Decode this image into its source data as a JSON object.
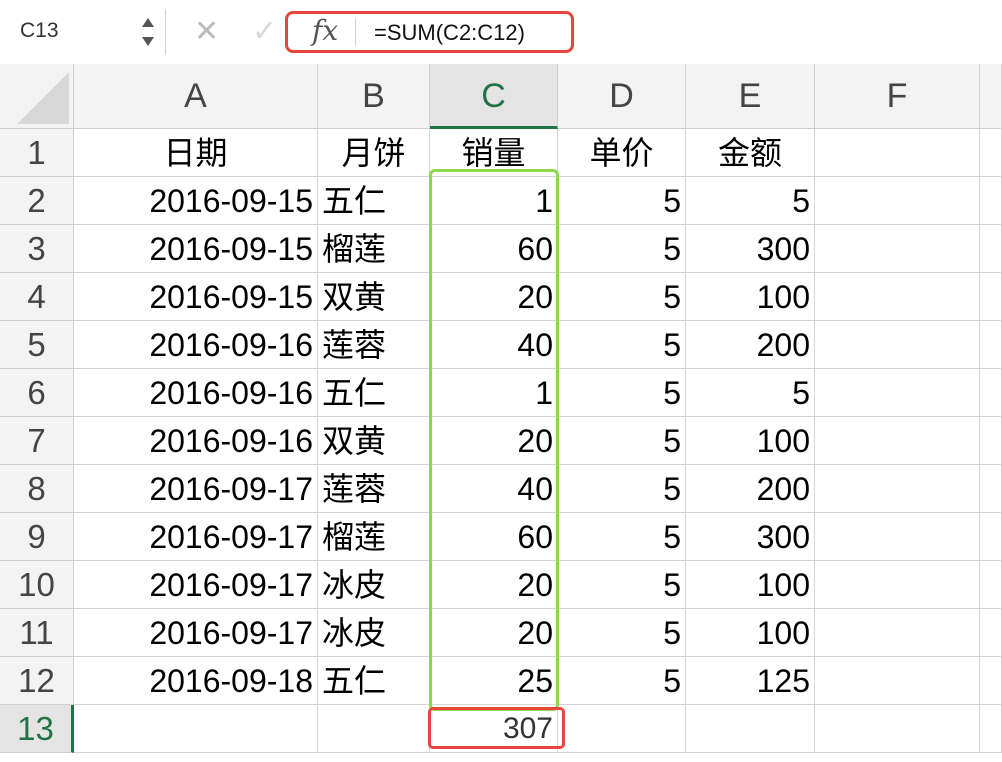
{
  "formula_bar": {
    "name_box": "C13",
    "cancel_glyph": "✕",
    "confirm_glyph": "✓",
    "fx_label": "fx",
    "formula": "=SUM(C2:C12)"
  },
  "columns": [
    "A",
    "B",
    "C",
    "D",
    "E",
    "F"
  ],
  "rows": [
    "1",
    "2",
    "3",
    "4",
    "5",
    "6",
    "7",
    "8",
    "9",
    "10",
    "11",
    "12",
    "13"
  ],
  "sheet": [
    [
      "日期",
      "月饼",
      "销量",
      "单价",
      "金额",
      ""
    ],
    [
      "2016-09-15",
      "五仁",
      "1",
      "5",
      "5",
      ""
    ],
    [
      "2016-09-15",
      "榴莲",
      "60",
      "5",
      "300",
      ""
    ],
    [
      "2016-09-15",
      "双黄",
      "20",
      "5",
      "100",
      ""
    ],
    [
      "2016-09-16",
      "莲蓉",
      "40",
      "5",
      "200",
      ""
    ],
    [
      "2016-09-16",
      "五仁",
      "1",
      "5",
      "5",
      ""
    ],
    [
      "2016-09-16",
      "双黄",
      "20",
      "5",
      "100",
      ""
    ],
    [
      "2016-09-17",
      "莲蓉",
      "40",
      "5",
      "200",
      ""
    ],
    [
      "2016-09-17",
      "榴莲",
      "60",
      "5",
      "300",
      ""
    ],
    [
      "2016-09-17",
      "冰皮",
      "20",
      "5",
      "100",
      ""
    ],
    [
      "2016-09-17",
      "冰皮",
      "20",
      "5",
      "100",
      ""
    ],
    [
      "2016-09-18",
      "五仁",
      "25",
      "5",
      "125",
      ""
    ],
    [
      "",
      "",
      "307",
      "",
      "",
      ""
    ]
  ],
  "selection": {
    "cell": "C13",
    "column": "C",
    "row": "13"
  },
  "highlights": {
    "range_color": "#8cd84a",
    "formula_color": "#e8453c"
  }
}
